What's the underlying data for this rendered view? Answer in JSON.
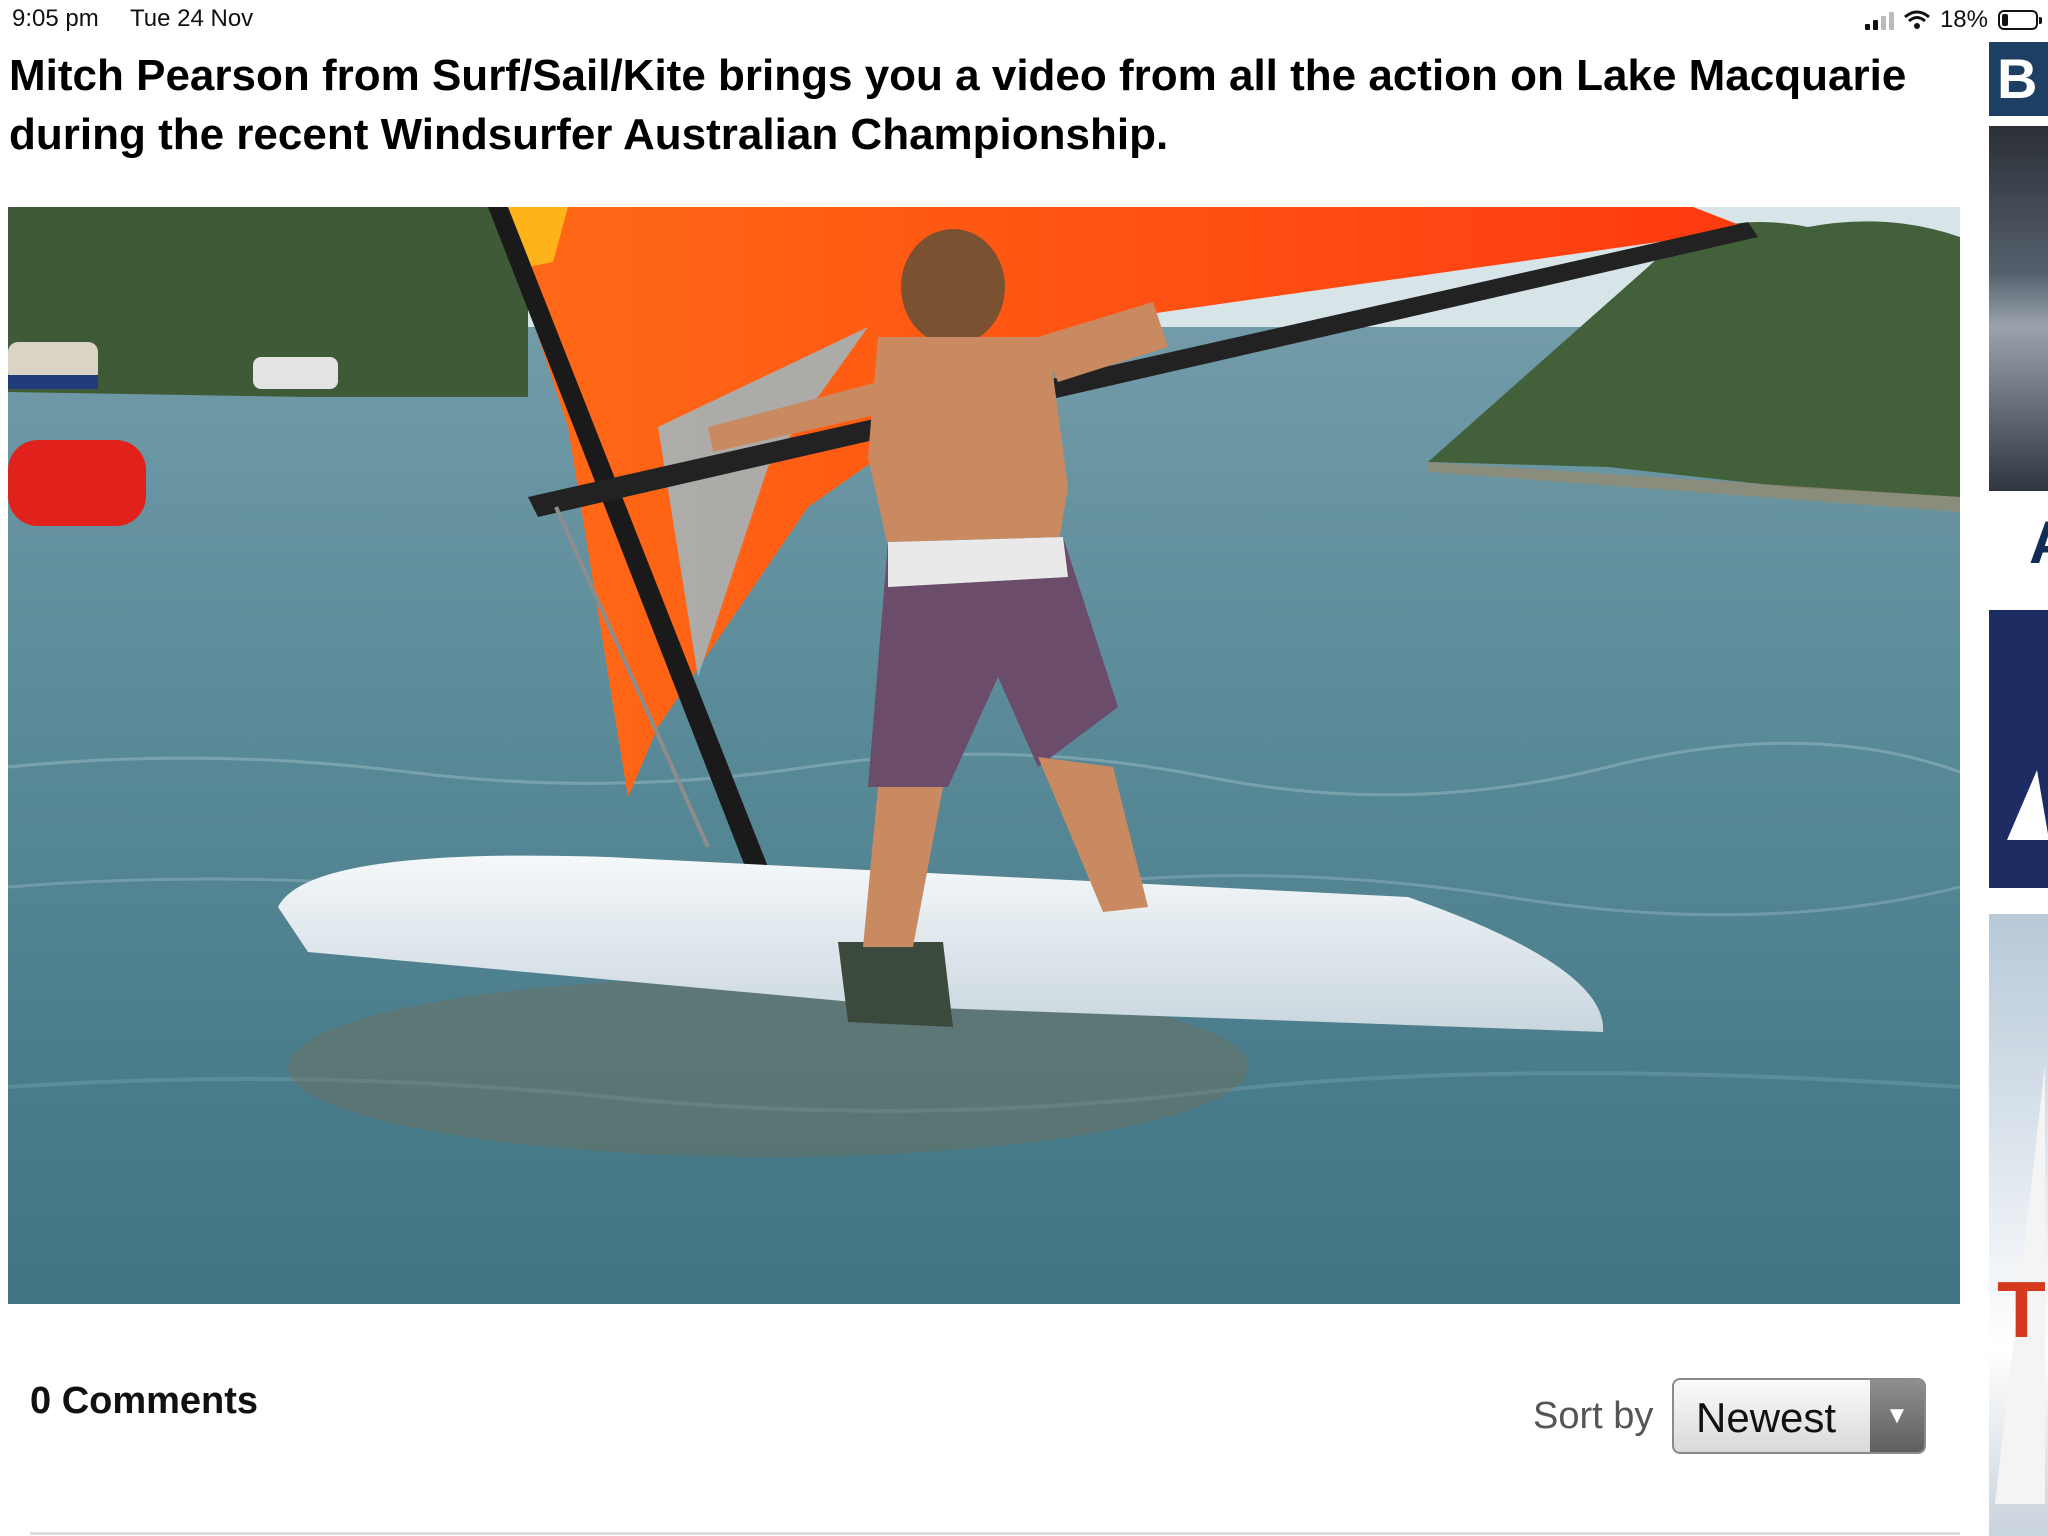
{
  "status_bar": {
    "time": "9:05 pm",
    "date": "Tue 24 Nov",
    "battery_percent_label": "18%",
    "battery_level": 0.18,
    "signal_bars": 2,
    "icons": [
      "cellular-signal-icon",
      "wifi-icon",
      "battery-icon"
    ]
  },
  "article": {
    "title": "Mitch Pearson from Surf/Sail/Kite brings you a video from all the action on Lake Macquarie during the recent Windsurfer Australian Championship."
  },
  "comments": {
    "count_label": "0 Comments",
    "sort_label": "Sort by",
    "sort_selected": "Newest"
  },
  "ad_strip": {
    "logo_letter": "B",
    "letter_fragment": "A",
    "mark_fragment": "T"
  },
  "colors": {
    "sail_orange": "#ff4a12",
    "sail_yellow": "#ffb31a",
    "lake_water": "#4b7f8f",
    "ad_navy": "#1d2c63"
  }
}
